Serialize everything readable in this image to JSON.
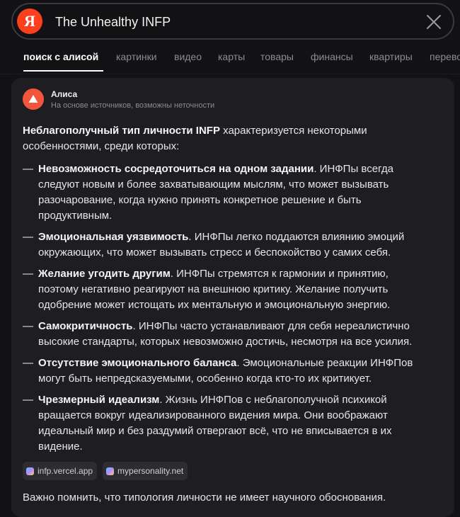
{
  "search": {
    "logo_letter": "Я",
    "query": "The Unhealthy INFP"
  },
  "tabs": [
    {
      "label": "поиск с алисой",
      "active": true
    },
    {
      "label": "картинки"
    },
    {
      "label": "видео"
    },
    {
      "label": "карты"
    },
    {
      "label": "товары"
    },
    {
      "label": "финансы"
    },
    {
      "label": "квартиры"
    },
    {
      "label": "переводчик"
    }
  ],
  "answer": {
    "author": "Алиса",
    "disclaimer": "На основе источников, возможны неточности",
    "intro_bold": "Неблагополучный тип личности INFP",
    "intro_rest": " характеризуется некоторыми особенностями, среди которых:",
    "items": [
      {
        "title": "Невозможность сосредоточиться на одном задании",
        "text": ". ИНФПы всегда следуют новым и более захватывающим мыслям, что может вызывать разочарование, когда нужно принять конкретное решение и быть продуктивным."
      },
      {
        "title": "Эмоциональная уязвимость",
        "text": ". ИНФПы легко поддаются влиянию эмоций окружающих, что может вызывать стресс и беспокойство у самих себя."
      },
      {
        "title": "Желание угодить другим",
        "text": ". ИНФПы стремятся к гармонии и принятию, поэтому негативно реагируют на внешнюю критику. Желание получить одобрение может истощать их ментальную и эмоциональную энергию."
      },
      {
        "title": "Самокритичность",
        "text": ". ИНФПы часто устанавливают для себя нереалистично высокие стандарты, которых невозможно достичь, несмотря на все усилия."
      },
      {
        "title": "Отсутствие эмоционального баланса",
        "text": ". Эмоциональные реакции ИНФПов могут быть непредсказуемыми, особенно когда кто-то их критикует."
      },
      {
        "title": "Чрезмерный идеализм",
        "text": ". Жизнь ИНФПов с неблагополучной психикой вращается вокруг идеализированного видения мира. Они воображают идеальный мир и без раздумий отвергают всё, что не вписывается в их видение."
      }
    ],
    "sources": [
      "infp.vercel.app",
      "mypersonality.net"
    ],
    "note": "Важно помнить, что типология личности не имеет научного обоснования."
  },
  "colors": {
    "background": "#121214",
    "card": "#1e1e22",
    "yandex_red": "#fc3f1d",
    "alice_accent": "#f2553c"
  }
}
